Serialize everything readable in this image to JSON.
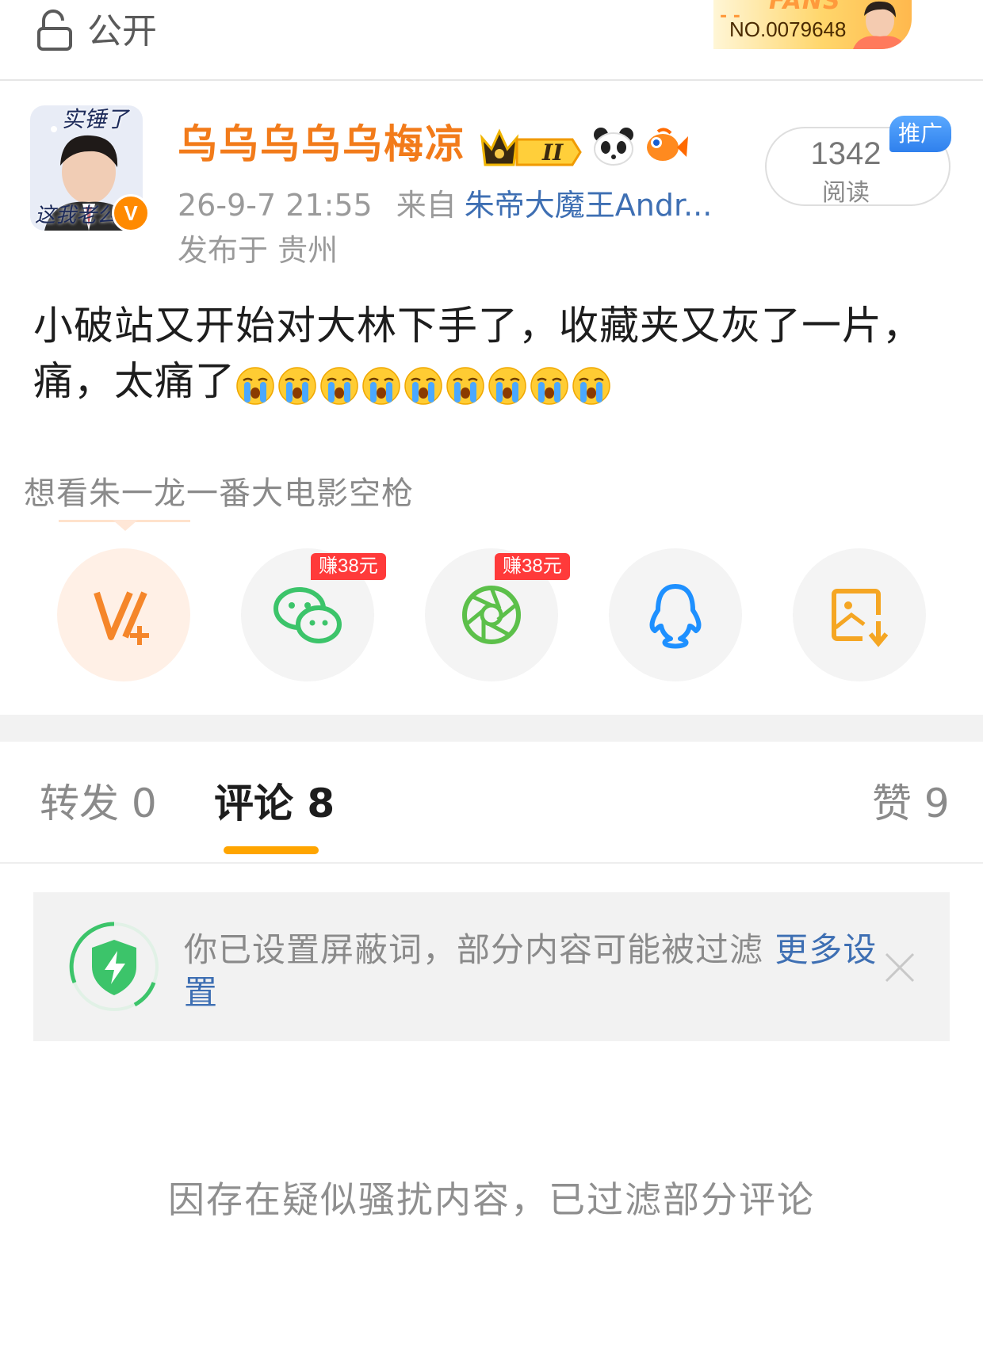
{
  "header": {
    "visibility_label": "公开",
    "fans_badge": {
      "word": "FANS",
      "number": "NO.0079648"
    }
  },
  "author": {
    "name": "乌乌乌乌乌梅凉",
    "avatar_caption_top": "实锤了",
    "avatar_caption_bottom": "这我老公",
    "verified_mark": "V",
    "vip_level": "II",
    "timestamp": "26-9-7 21:55",
    "from_label": "来自",
    "device": "朱帝大魔王Andr...",
    "location": "发布于 贵州"
  },
  "reads": {
    "count": "1342",
    "label": "阅读",
    "promo_label": "推广"
  },
  "post": {
    "text": "小破站又开始对大林下手了，收藏夹又灰了一片，痛，太痛了",
    "emoji": "crying-face",
    "emoji_count": 9
  },
  "supertopic": "想看朱一龙一番大电影空枪",
  "share": {
    "earn_wechat": "赚38元",
    "earn_moments": "赚38元",
    "icons": [
      "vplus-icon",
      "wechat-icon",
      "moments-icon",
      "qq-icon",
      "save-image-icon"
    ]
  },
  "tabs": {
    "repost": "转发 0",
    "comment": "评论 8",
    "like": "赞 9",
    "active": "comment"
  },
  "filter_notice": {
    "text": "你已设置屏蔽词，部分内容可能被过滤 ",
    "link": "更多设置"
  },
  "footer_notice": "因存在疑似骚扰内容，已过滤部分评论",
  "colors": {
    "author_name": "#f27b1a",
    "link": "#3e6fb3",
    "tab_indicator": "#ffa500",
    "earn_tag": "#ff3a3a"
  }
}
